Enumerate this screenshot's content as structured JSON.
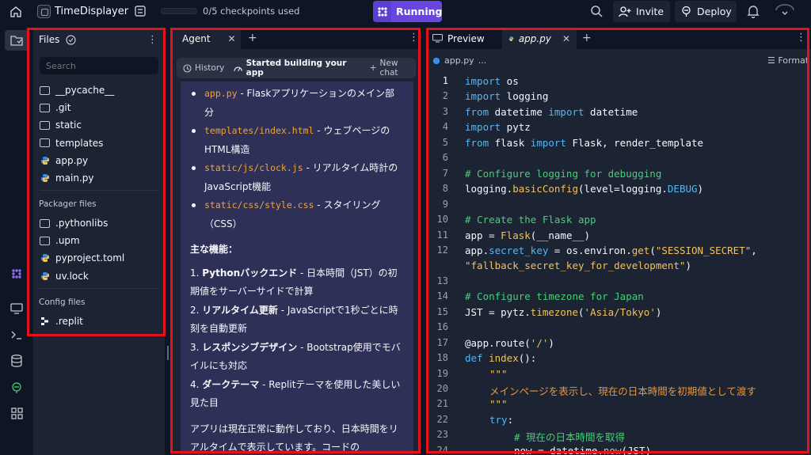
{
  "topbar": {
    "repl_name": "TimeDisplayer",
    "checkpoints": "0/5 checkpoints used",
    "running_label": "Running",
    "invite_label": "Invite",
    "deploy_label": "Deploy"
  },
  "files": {
    "title": "Files",
    "search_placeholder": "Search",
    "items": [
      {
        "name": "__pycache__",
        "type": "folder"
      },
      {
        "name": ".git",
        "type": "folder"
      },
      {
        "name": "static",
        "type": "folder"
      },
      {
        "name": "templates",
        "type": "folder"
      },
      {
        "name": "app.py",
        "type": "python"
      },
      {
        "name": "main.py",
        "type": "python"
      }
    ],
    "packager_title": "Packager files",
    "packager_items": [
      {
        "name": ".pythonlibs",
        "type": "folder"
      },
      {
        "name": ".upm",
        "type": "folder"
      },
      {
        "name": "pyproject.toml",
        "type": "python"
      },
      {
        "name": "uv.lock",
        "type": "python"
      }
    ],
    "config_title": "Config files",
    "config_items": [
      {
        "name": ".replit",
        "type": "replit"
      }
    ]
  },
  "agent": {
    "tab_label": "Agent",
    "history_label": "History",
    "status_label": "Started building your app",
    "new_chat_label": "New chat",
    "bullets": [
      {
        "code": "app.py",
        "text": " - Flaskアプリケーションのメイン部分"
      },
      {
        "code": "templates/index.html",
        "text": " - ウェブページのHTML構造"
      },
      {
        "code": "static/js/clock.js",
        "text": " - リアルタイム時計のJavaScript機能"
      },
      {
        "code": "static/css/style.css",
        "text": " - スタイリング（CSS）"
      }
    ],
    "features_heading": "主な機能：",
    "features": [
      {
        "num": "1.",
        "bold": "Pythonバックエンド",
        "text": " - 日本時間（JST）の初期値をサーバーサイドで計算"
      },
      {
        "num": "2.",
        "bold": "リアルタイム更新",
        "text": " - JavaScriptで1秒ごとに時刻を自動更新"
      },
      {
        "num": "3.",
        "bold": "レスポンシブデザイン",
        "text": " - Bootstrap使用でモバイルにも対応"
      },
      {
        "num": "4.",
        "bold": "ダークテーマ",
        "text": " - Replitテーマを使用した美しい見た目"
      }
    ],
    "closing": "アプリは現在正常に動作しており、日本時間をリアルタイムで表示しています。コードの"
  },
  "editor": {
    "preview_tab": "Preview",
    "file_tab": "app.py",
    "breadcrumb_file": "app.py",
    "breadcrumb_more": "...",
    "format_label": "Format",
    "current_line": 1,
    "lines": [
      {
        "n": "1",
        "indent": 0,
        "parts": [
          {
            "c": "kw",
            "t": "import"
          },
          {
            "c": "",
            "t": " os"
          }
        ]
      },
      {
        "n": "2",
        "indent": 0,
        "parts": [
          {
            "c": "kw",
            "t": "import"
          },
          {
            "c": "",
            "t": " logging"
          }
        ]
      },
      {
        "n": "3",
        "indent": 0,
        "parts": [
          {
            "c": "kw",
            "t": "from"
          },
          {
            "c": "",
            "t": " datetime "
          },
          {
            "c": "kw",
            "t": "import"
          },
          {
            "c": "",
            "t": " datetime"
          }
        ]
      },
      {
        "n": "4",
        "indent": 0,
        "parts": [
          {
            "c": "kw",
            "t": "import"
          },
          {
            "c": "",
            "t": " pytz"
          }
        ]
      },
      {
        "n": "5",
        "indent": 0,
        "parts": [
          {
            "c": "kw",
            "t": "from"
          },
          {
            "c": "",
            "t": " flask "
          },
          {
            "c": "kw",
            "t": "import"
          },
          {
            "c": "",
            "t": " Flask, render_template"
          }
        ]
      },
      {
        "n": "6",
        "indent": 0,
        "parts": []
      },
      {
        "n": "7",
        "indent": 0,
        "parts": [
          {
            "c": "cm",
            "t": "# Configure logging for debugging"
          }
        ]
      },
      {
        "n": "8",
        "indent": 0,
        "parts": [
          {
            "c": "",
            "t": "logging."
          },
          {
            "c": "fn",
            "t": "basicConfig"
          },
          {
            "c": "",
            "t": "(level=logging."
          },
          {
            "c": "attr",
            "t": "DEBUG"
          },
          {
            "c": "",
            "t": ")"
          }
        ]
      },
      {
        "n": "9",
        "indent": 0,
        "parts": []
      },
      {
        "n": "10",
        "indent": 0,
        "parts": [
          {
            "c": "cm",
            "t": "# Create the Flask app"
          }
        ]
      },
      {
        "n": "11",
        "indent": 0,
        "parts": [
          {
            "c": "",
            "t": "app = "
          },
          {
            "c": "fn",
            "t": "Flask"
          },
          {
            "c": "",
            "t": "(__name__)"
          }
        ]
      },
      {
        "n": "12",
        "indent": 0,
        "parts": [
          {
            "c": "",
            "t": "app."
          },
          {
            "c": "attr",
            "t": "secret_key"
          },
          {
            "c": "",
            "t": " = os.environ."
          },
          {
            "c": "fn",
            "t": "get"
          },
          {
            "c": "",
            "t": "("
          },
          {
            "c": "str",
            "t": "\"SESSION_SECRET\""
          },
          {
            "c": "",
            "t": ","
          }
        ]
      },
      {
        "n": "",
        "indent": 0,
        "parts": [
          {
            "c": "str",
            "t": "\"fallback_secret_key_for_development\""
          },
          {
            "c": "",
            "t": ")"
          }
        ]
      },
      {
        "n": "13",
        "indent": 0,
        "parts": []
      },
      {
        "n": "14",
        "indent": 0,
        "parts": [
          {
            "c": "cm",
            "t": "# Configure timezone for Japan"
          }
        ]
      },
      {
        "n": "15",
        "indent": 0,
        "parts": [
          {
            "c": "",
            "t": "JST = pytz."
          },
          {
            "c": "fn",
            "t": "timezone"
          },
          {
            "c": "",
            "t": "("
          },
          {
            "c": "str",
            "t": "'Asia/Tokyo'"
          },
          {
            "c": "",
            "t": ")"
          }
        ]
      },
      {
        "n": "16",
        "indent": 0,
        "parts": []
      },
      {
        "n": "17",
        "indent": 0,
        "parts": [
          {
            "c": "",
            "t": "@app."
          },
          {
            "c": "",
            "t": "route("
          },
          {
            "c": "str",
            "t": "'/'"
          },
          {
            "c": "",
            "t": ")"
          }
        ]
      },
      {
        "n": "18",
        "indent": 0,
        "parts": [
          {
            "c": "kw",
            "t": "def"
          },
          {
            "c": "",
            "t": " "
          },
          {
            "c": "fn",
            "t": "index"
          },
          {
            "c": "",
            "t": "():"
          }
        ]
      },
      {
        "n": "19",
        "indent": 1,
        "parts": [
          {
            "c": "str",
            "t": "\"\"\""
          }
        ]
      },
      {
        "n": "20",
        "indent": 1,
        "parts": [
          {
            "c": "ja",
            "t": "メインページを表示し、現在の日本時間を初期値として渡す"
          }
        ]
      },
      {
        "n": "21",
        "indent": 1,
        "parts": [
          {
            "c": "str",
            "t": "\"\"\""
          }
        ]
      },
      {
        "n": "22",
        "indent": 1,
        "parts": [
          {
            "c": "kw",
            "t": "try"
          },
          {
            "c": "",
            "t": ":"
          }
        ]
      },
      {
        "n": "23",
        "indent": 2,
        "parts": [
          {
            "c": "cm",
            "t": "# 現在の日本時間を取得"
          }
        ]
      },
      {
        "n": "24",
        "indent": 2,
        "parts": [
          {
            "c": "",
            "t": "now = datetime."
          },
          {
            "c": "fn",
            "t": "now"
          },
          {
            "c": "",
            "t": "(JST)"
          }
        ]
      }
    ]
  }
}
